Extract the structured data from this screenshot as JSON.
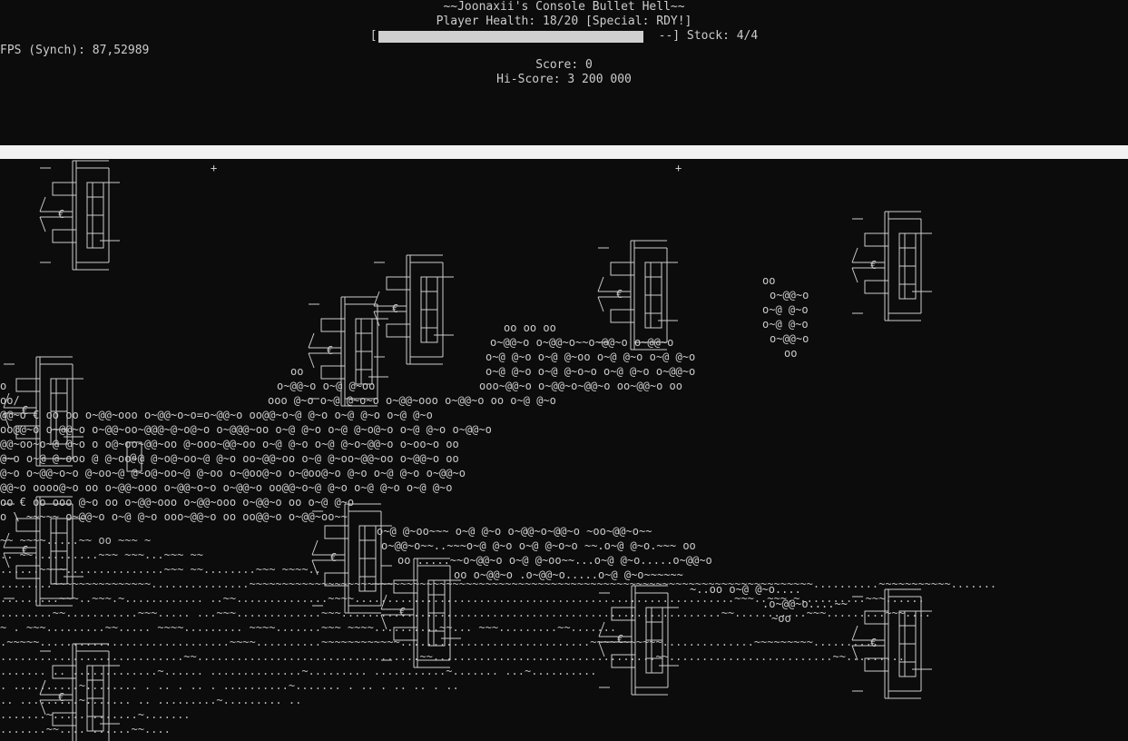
{
  "hud": {
    "title": "~~Joonaxii's Console Bullet Hell~~",
    "health_text": "Player Health: 18/20 [Special: RDY!]",
    "bar_open": "[",
    "bar_close": "--] Stock: 4/4",
    "special_charge": 0.95,
    "fps_text": "FPS (Synch): 87,52989",
    "score_text": "Score: 0",
    "hiscore_text": "Hi-Score: 3 200 000"
  },
  "field": {
    "player_glyph": "@",
    "enemy_glyph": "€",
    "star_glyph": "+",
    "bullet_ring": "o~@@~o",
    "colors": {
      "background": "#0c0c0c",
      "foreground": "#cccccc",
      "separator": "#f2f2f2"
    }
  }
}
